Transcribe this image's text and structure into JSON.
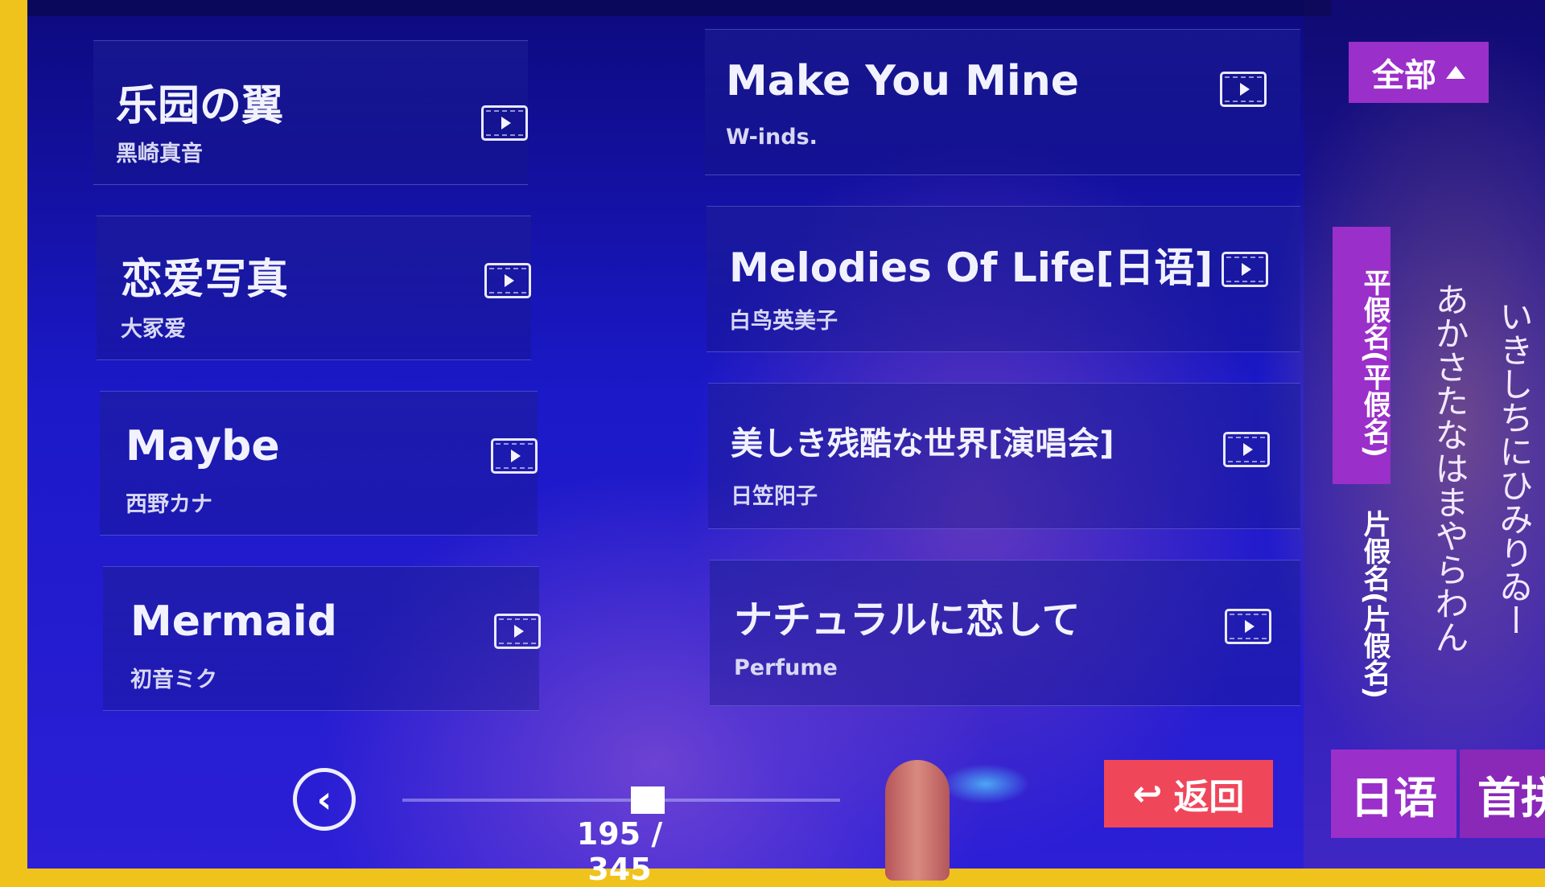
{
  "songs": [
    {
      "title": "乐园の翼",
      "artist": "黑崎真音"
    },
    {
      "title": "Make You Mine",
      "artist": "W-inds."
    },
    {
      "title": "恋爱写真",
      "artist": "大冢爱"
    },
    {
      "title": "Melodies Of Life[日语]",
      "artist": "白鸟英美子"
    },
    {
      "title": "Maybe",
      "artist": "西野カナ"
    },
    {
      "title": "美しき残酷な世界[演唱会]",
      "artist": "日笠阳子"
    },
    {
      "title": "Mermaid",
      "artist": "初音ミク"
    },
    {
      "title": "ナチュラルに恋して",
      "artist": "Perfume"
    }
  ],
  "filter": {
    "all_label": "全部"
  },
  "kana_tabs": {
    "hiragana": "平假名(平假名)",
    "katakana": "片假名(片假名)"
  },
  "kana_columns": {
    "col1": "あかさたなはまやらわん",
    "col2": "いきしちにひみりゐー"
  },
  "pagination": {
    "counter": "195 / 345",
    "current": 195,
    "total": 345
  },
  "actions": {
    "return_label": "返回"
  },
  "language_tabs": {
    "japanese": "日语",
    "pinyin": "首拼"
  },
  "colors": {
    "accent": "#9a2fc9",
    "return": "#f0465a",
    "background": "#1b19c8"
  }
}
